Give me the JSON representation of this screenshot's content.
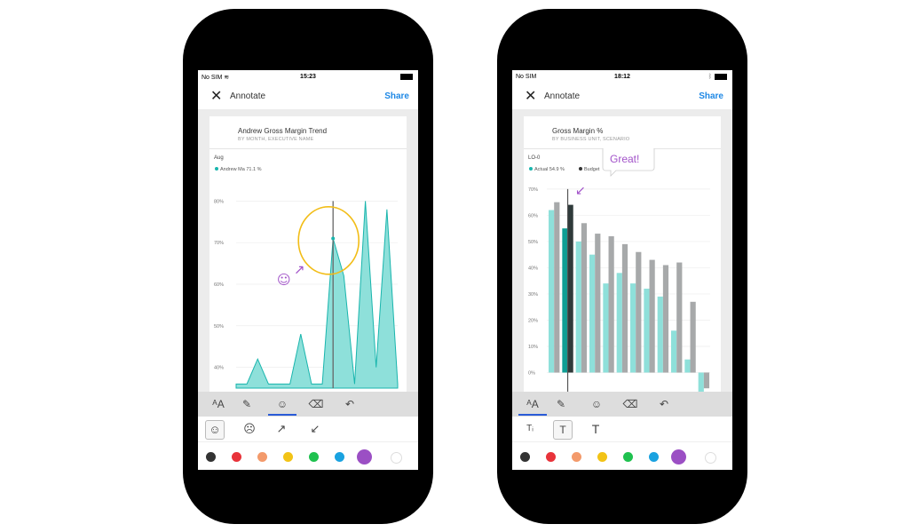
{
  "phones": [
    {
      "status": {
        "carrier": "No SIM",
        "time": "15:23"
      },
      "appbar": {
        "title": "Annotate",
        "share": "Share"
      },
      "card": {
        "title": "Andrew Gross Margin Trend",
        "subtitle": "BY MONTH, EXECUTIVE NAME"
      },
      "chart_data": {
        "type": "area",
        "header_label": "Aug",
        "legend": [
          {
            "name": "Andrew Ma",
            "value": "71.1 %",
            "color": "#19b5ad"
          }
        ],
        "y_ticks": [
          "80%",
          "70%",
          "60%",
          "50%",
          "40%"
        ],
        "ylim": [
          35,
          82
        ],
        "x": [
          0,
          1,
          2,
          3,
          4,
          5,
          6,
          7,
          8,
          9,
          10,
          11,
          12,
          13,
          14,
          15
        ],
        "series": [
          {
            "values": [
              36,
              36,
              42,
              36,
              36,
              36,
              48,
              36,
              36,
              71,
              62,
              36,
              80,
              40,
              78,
              36
            ]
          }
        ],
        "highlight_index": 9
      },
      "annotations": {
        "smiley": "☺",
        "arrow": "↗",
        "circle_color": "#f2bd17",
        "ink_color": "#a253c9"
      },
      "toolbar": [
        {
          "icon": "text-size-icon",
          "glyph": "ᴬA",
          "active": false
        },
        {
          "icon": "pen-icon",
          "glyph": "✎",
          "active": false
        },
        {
          "icon": "smiley-icon",
          "glyph": "☺",
          "active": true
        },
        {
          "icon": "eraser-icon",
          "glyph": "⌫",
          "active": false
        },
        {
          "icon": "undo-icon",
          "glyph": "↶",
          "active": false
        }
      ],
      "subtools": [
        {
          "icon": "happy-face-icon",
          "glyph": "☺",
          "selected": true
        },
        {
          "icon": "sad-face-icon",
          "glyph": "☹",
          "selected": false
        },
        {
          "icon": "arrow-up-right-icon",
          "glyph": "↗",
          "selected": false
        },
        {
          "icon": "arrow-down-left-icon",
          "glyph": "↙",
          "selected": false
        }
      ],
      "palette": [
        "#333333",
        "#e8333a",
        "#f39a6b",
        "#f2c316",
        "#1fc14f",
        "#1aa2e0",
        "#9b4fc4",
        "#ffffff"
      ],
      "palette_selected": 6
    },
    {
      "status": {
        "carrier": "No SIM",
        "time": "18:12"
      },
      "appbar": {
        "title": "Annotate",
        "share": "Share"
      },
      "card": {
        "title": "Gross Margin %",
        "subtitle": "BY BUSINESS UNIT, SCENARIO"
      },
      "chart_data": {
        "type": "bar",
        "header_label": "LO-0",
        "legend": [
          {
            "name": "Actual",
            "value": "54.9 %",
            "color": "#19b5ad"
          },
          {
            "name": "Budget",
            "value": "",
            "color": "#333333"
          }
        ],
        "y_ticks": [
          "70%",
          "60%",
          "50%",
          "40%",
          "30%",
          "20%",
          "10%",
          "0%"
        ],
        "ylim": [
          -10,
          72
        ],
        "series": [
          {
            "name": "Actual",
            "values": [
              62,
              55,
              50,
              45,
              34,
              38,
              34,
              32,
              29,
              16,
              5,
              -10
            ]
          },
          {
            "name": "Budget",
            "values": [
              65,
              64,
              57,
              53,
              52,
              49,
              46,
              43,
              41,
              42,
              27,
              -6
            ]
          }
        ],
        "highlight_index": 1
      },
      "annotations": {
        "bubble": "Great!",
        "arrow": "↙",
        "ink_color": "#a253c9"
      },
      "toolbar": [
        {
          "icon": "text-size-icon",
          "glyph": "ᴬA",
          "active": true
        },
        {
          "icon": "pen-icon",
          "glyph": "✎",
          "active": false
        },
        {
          "icon": "smiley-icon",
          "glyph": "☺",
          "active": false
        },
        {
          "icon": "eraser-icon",
          "glyph": "⌫",
          "active": false
        },
        {
          "icon": "undo-icon",
          "glyph": "↶",
          "active": false
        }
      ],
      "subtools": [
        {
          "icon": "text-small-icon",
          "glyph": "Tᵢ",
          "selected": false
        },
        {
          "icon": "text-medium-icon",
          "glyph": "T",
          "selected": true
        },
        {
          "icon": "text-large-icon",
          "glyph": "T",
          "selected": false
        }
      ],
      "palette": [
        "#333333",
        "#e8333a",
        "#f39a6b",
        "#f2c316",
        "#1fc14f",
        "#1aa2e0",
        "#9b4fc4",
        "#ffffff"
      ],
      "palette_selected": 6
    }
  ]
}
